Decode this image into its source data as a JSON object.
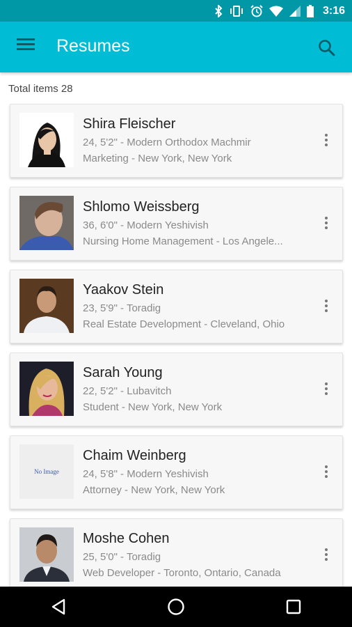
{
  "status_bar": {
    "time": "3:16",
    "icons": [
      "bluetooth-icon",
      "vibrate-icon",
      "alarm-icon",
      "wifi-icon",
      "signal-icon",
      "battery-icon"
    ]
  },
  "app_bar": {
    "title": "Resumes",
    "menu_icon": "menu-icon",
    "search_icon": "search-icon"
  },
  "list_header": {
    "total_label": "Total items 28"
  },
  "resumes": [
    {
      "name": "Shira Fleischer",
      "details": "24, 5'2\" - Modern Orthodox Machmir",
      "profession_location": "Marketing - New York, New York",
      "photo": "woman-portrait"
    },
    {
      "name": "Shlomo Weissberg",
      "details": "36, 6'0\" - Modern Yeshivish",
      "profession_location": "Nursing Home Management - Los Angele...",
      "photo": "man-portrait"
    },
    {
      "name": "Yaakov Stein",
      "details": "23, 5'9\" - Toradig",
      "profession_location": "Real Estate Development - Cleveland, Ohio",
      "photo": "man-portrait"
    },
    {
      "name": "Sarah Young",
      "details": "22, 5'2\" - Lubavitch",
      "profession_location": "Student - New York, New York",
      "photo": "woman-portrait"
    },
    {
      "name": "Chaim Weinberg",
      "details": "24, 5'8\" - Modern Yeshivish",
      "profession_location": "Attorney - New York, New York",
      "photo": "no-image",
      "no_image_text": "No Image"
    },
    {
      "name": "Moshe Cohen",
      "details": "25, 5'0\" - Toradig",
      "profession_location": "Web Developer - Toronto, Ontario, Canada",
      "photo": "man-portrait"
    }
  ],
  "nav_bar": {
    "buttons": [
      "back-icon",
      "home-icon",
      "recents-icon"
    ]
  },
  "colors": {
    "app_bar": "#00bcd4",
    "status_bar": "#0097a7",
    "card_bg": "#f7f7f7"
  }
}
